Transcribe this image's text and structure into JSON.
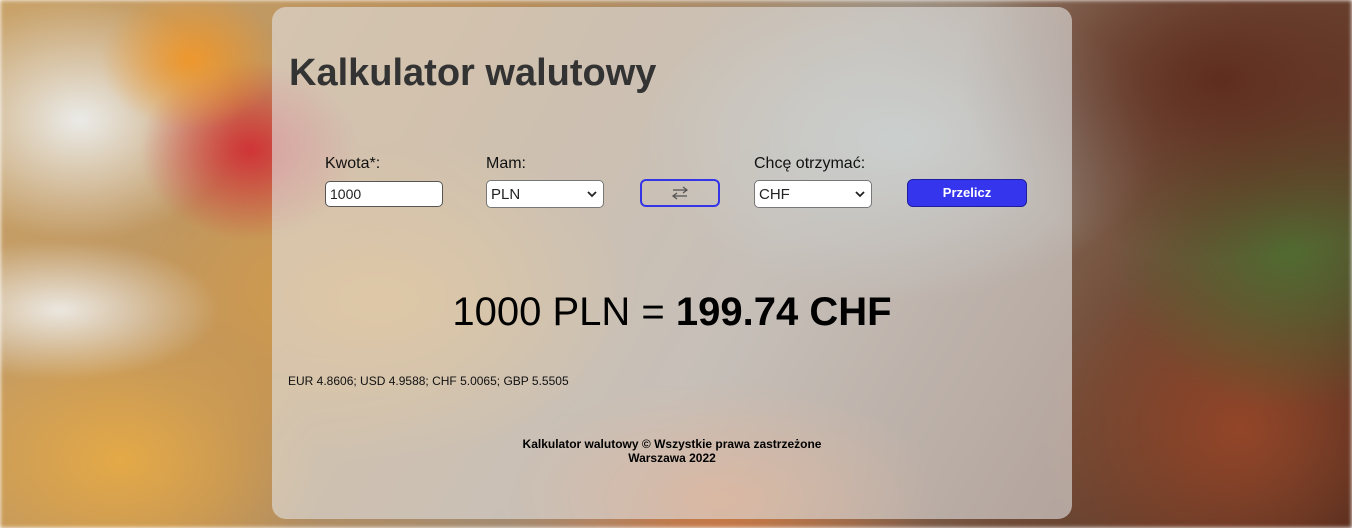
{
  "app": {
    "title": "Kalkulator walutowy"
  },
  "form": {
    "amount_label": "Kwota*:",
    "amount_value": "1000",
    "from_label": "Mam:",
    "from_value": "PLN",
    "to_label": "Chcę otrzymać:",
    "to_value": "CHF",
    "swap_icon": "swap-arrows-icon",
    "convert_label": "Przelicz"
  },
  "result": {
    "left": "1000 PLN = ",
    "right": "199.74 CHF"
  },
  "rates": "EUR 4.8606; USD 4.9588; CHF 5.0065; GBP 5.5505",
  "footer": {
    "line1": "Kalkulator walutowy © Wszystkie prawa zastrzeżone",
    "line2": "Warszawa 2022"
  },
  "colors": {
    "accent": "#3535ee",
    "panel": "rgba(225,225,225,0.62)",
    "title": "#333333"
  }
}
